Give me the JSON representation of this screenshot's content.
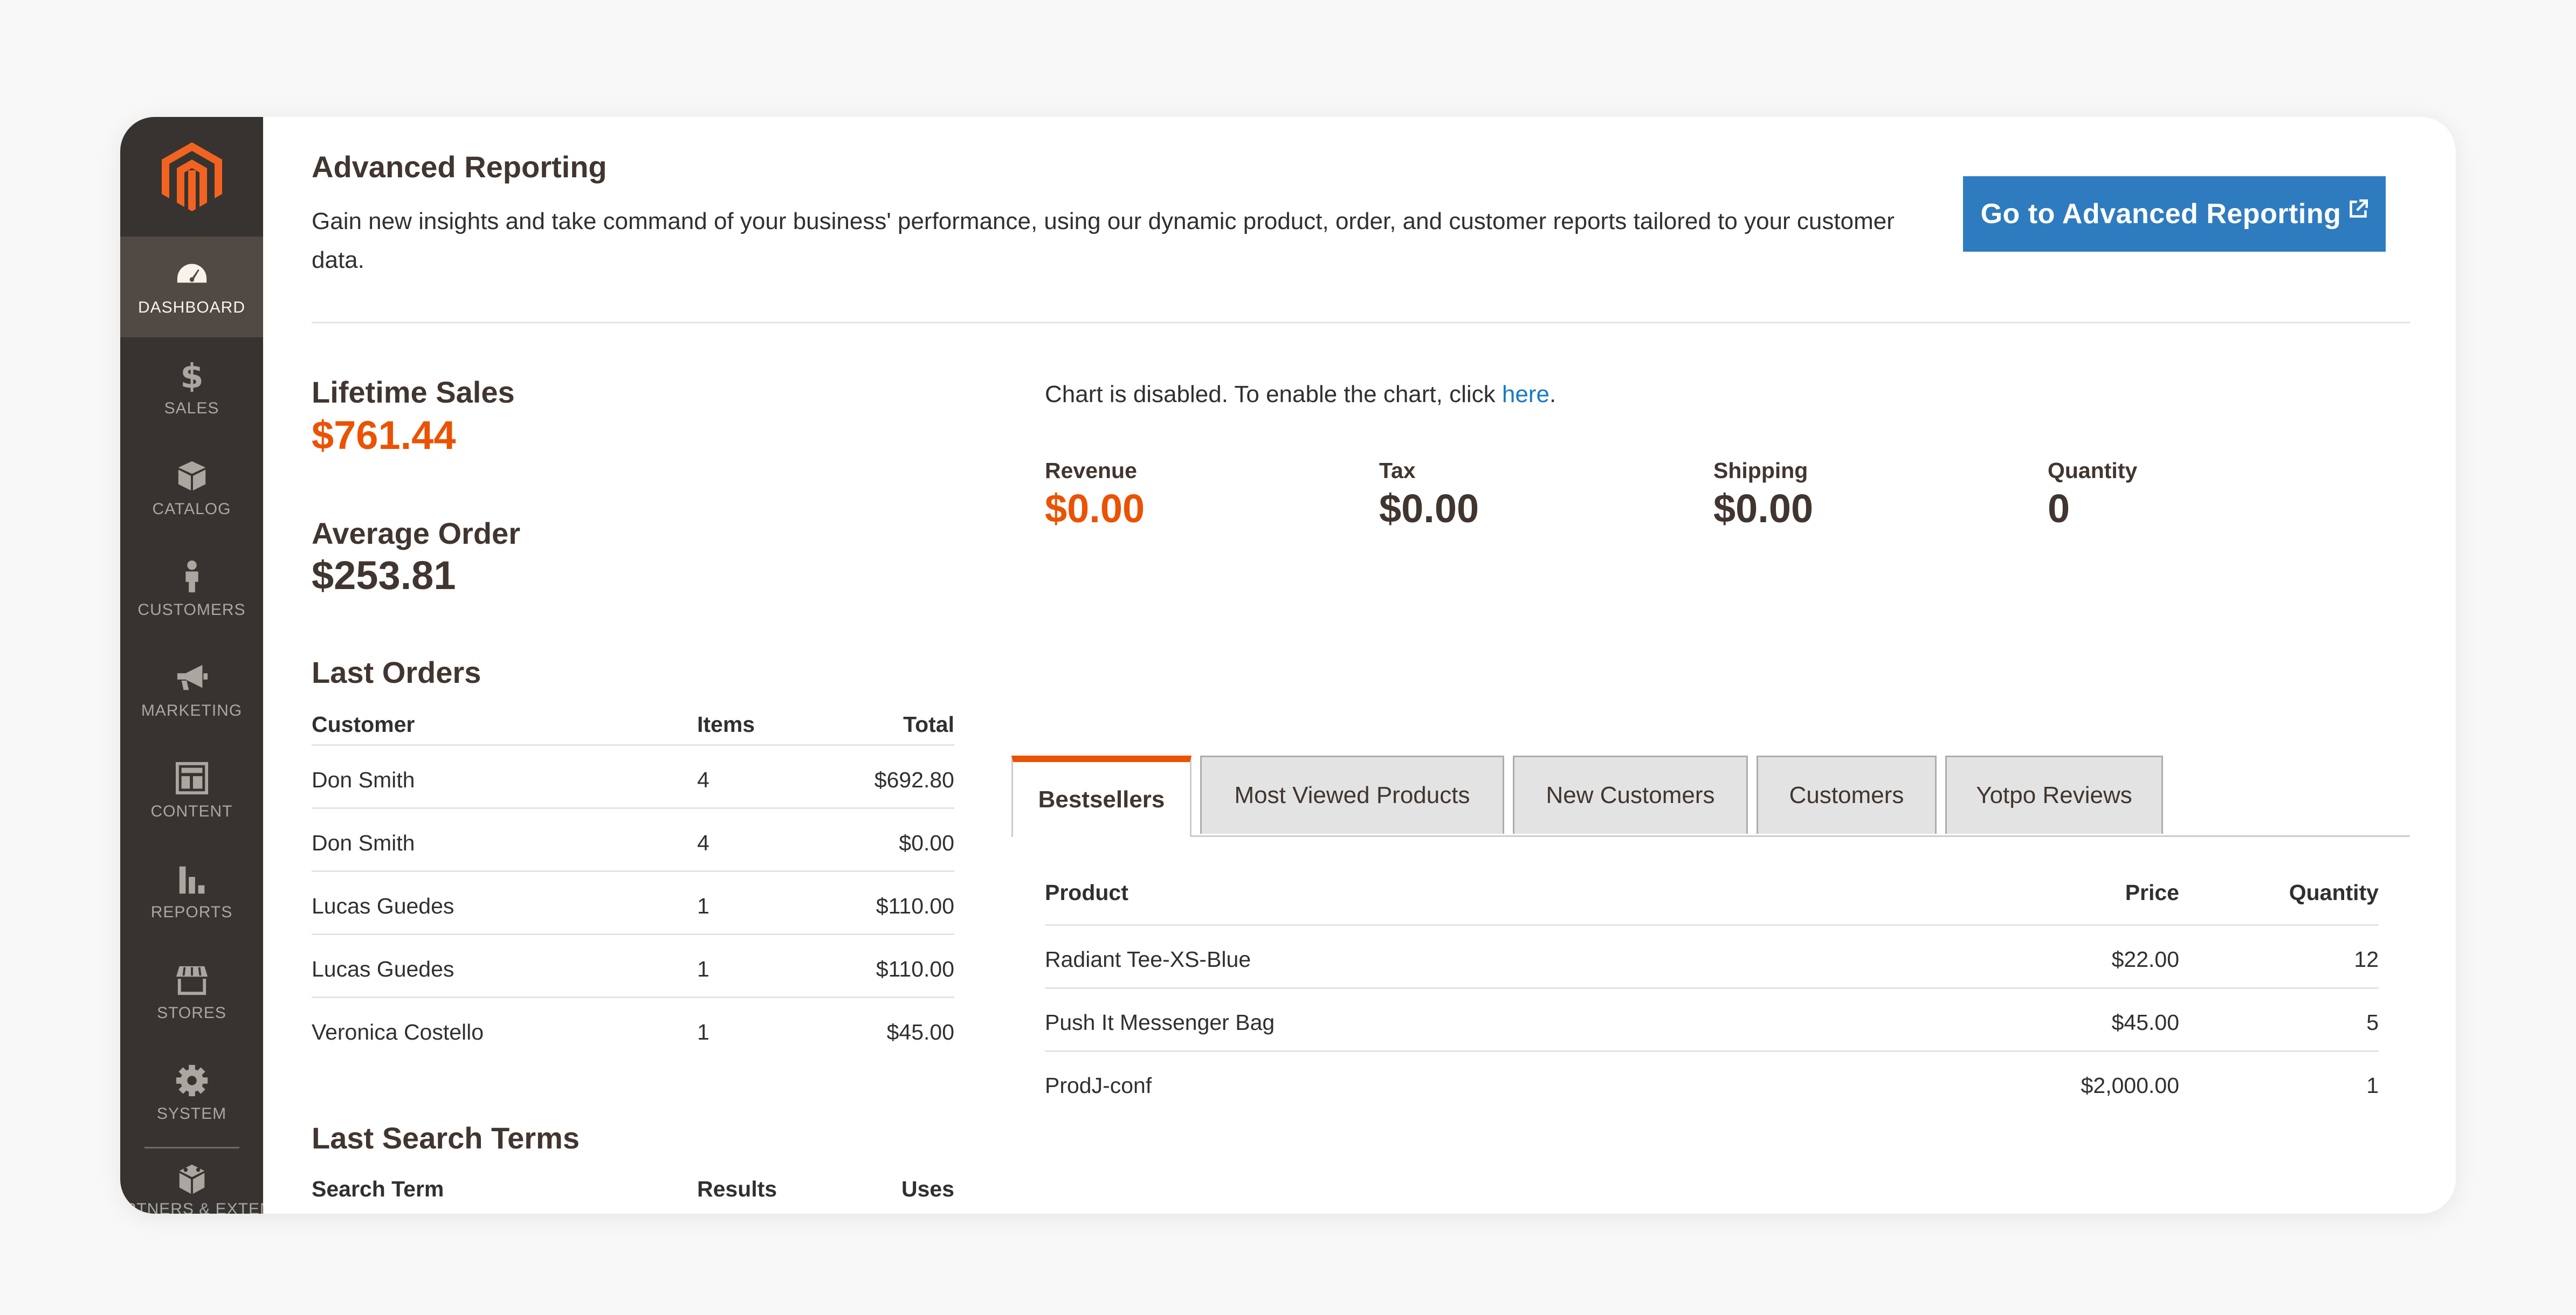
{
  "colors": {
    "sidebar_bg": "#373330",
    "sidebar_active": "#514943",
    "accent_orange": "#eb5202",
    "button_blue": "#2f7bbf",
    "link_blue": "#1979c3"
  },
  "sidebar": {
    "items": [
      {
        "label": "DASHBOARD",
        "icon": "dashboard-icon",
        "active": true
      },
      {
        "label": "SALES",
        "icon": "dollar-icon"
      },
      {
        "label": "CATALOG",
        "icon": "box-icon"
      },
      {
        "label": "CUSTOMERS",
        "icon": "person-icon"
      },
      {
        "label": "MARKETING",
        "icon": "megaphone-icon"
      },
      {
        "label": "CONTENT",
        "icon": "layout-icon"
      },
      {
        "label": "REPORTS",
        "icon": "bar-chart-icon"
      },
      {
        "label": "STORES",
        "icon": "store-icon"
      },
      {
        "label": "SYSTEM",
        "icon": "gear-icon"
      }
    ],
    "partial_label": "FIND PARTNERS & EXTENSIONS",
    "partial_icon": "blocks-icon"
  },
  "advanced": {
    "title": "Advanced Reporting",
    "description": "Gain new insights and take command of your business' performance, using our dynamic product, order, and customer reports tailored to your customer data.",
    "button_label": "Go to Advanced Reporting"
  },
  "stats": {
    "lifetime_sales_label": "Lifetime Sales",
    "lifetime_sales_value": "$761.44",
    "average_order_label": "Average Order",
    "average_order_value": "$253.81"
  },
  "last_orders": {
    "title": "Last Orders",
    "headers": {
      "customer": "Customer",
      "items": "Items",
      "total": "Total"
    },
    "rows": [
      {
        "customer": "Don Smith",
        "items": "4",
        "total": "$692.80"
      },
      {
        "customer": "Don Smith",
        "items": "4",
        "total": "$0.00"
      },
      {
        "customer": "Lucas Guedes",
        "items": "1",
        "total": "$110.00"
      },
      {
        "customer": "Lucas Guedes",
        "items": "1",
        "total": "$110.00"
      },
      {
        "customer": "Veronica Costello",
        "items": "1",
        "total": "$45.00"
      }
    ]
  },
  "last_search": {
    "title": "Last Search Terms",
    "headers": {
      "term": "Search Term",
      "results": "Results",
      "uses": "Uses"
    }
  },
  "chart": {
    "message": "Chart is disabled. To enable the chart, click ",
    "link": "here",
    "suffix": "."
  },
  "totals": [
    {
      "label": "Revenue",
      "value": "$0.00",
      "accent": true
    },
    {
      "label": "Tax",
      "value": "$0.00"
    },
    {
      "label": "Shipping",
      "value": "$0.00"
    },
    {
      "label": "Quantity",
      "value": "0"
    }
  ],
  "tabs": [
    {
      "label": "Bestsellers",
      "active": true
    },
    {
      "label": "Most Viewed Products"
    },
    {
      "label": "New Customers"
    },
    {
      "label": "Customers"
    },
    {
      "label": "Yotpo Reviews"
    }
  ],
  "bestsellers": {
    "headers": {
      "product": "Product",
      "price": "Price",
      "quantity": "Quantity"
    },
    "rows": [
      {
        "product": "Radiant Tee-XS-Blue",
        "price": "$22.00",
        "quantity": "12"
      },
      {
        "product": "Push It Messenger Bag",
        "price": "$45.00",
        "quantity": "5"
      },
      {
        "product": "ProdJ-conf",
        "price": "$2,000.00",
        "quantity": "1"
      }
    ]
  }
}
